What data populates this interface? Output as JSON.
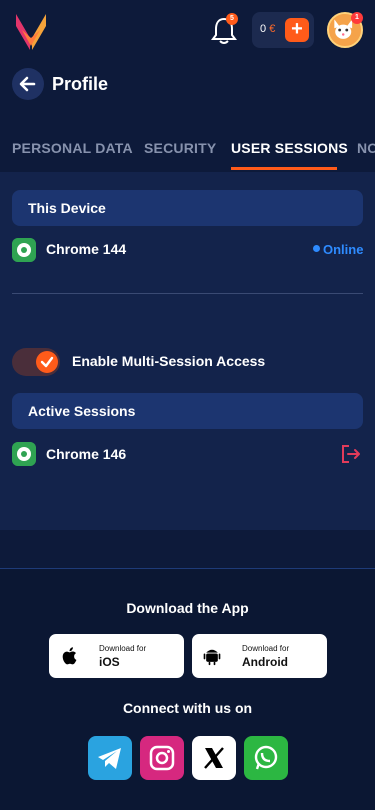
{
  "header": {
    "notification_count": "5",
    "balance_amount": "0",
    "balance_currency": "€",
    "avatar_badge_count": "1"
  },
  "page": {
    "title": "Profile"
  },
  "tabs": [
    {
      "label": "PERSONAL DATA",
      "active": false
    },
    {
      "label": "SECURITY",
      "active": false
    },
    {
      "label": "USER SESSIONS",
      "active": true
    },
    {
      "label": "NO",
      "active": false
    }
  ],
  "this_device": {
    "heading": "This Device",
    "browser": "Chrome 144",
    "status": "Online"
  },
  "multi_session": {
    "label": "Enable Multi-Session Access",
    "enabled": true
  },
  "active_sessions": {
    "heading": "Active Sessions",
    "items": [
      {
        "browser": "Chrome 146"
      }
    ]
  },
  "footer": {
    "download_title": "Download the App",
    "ios": {
      "small": "Download for",
      "big": "iOS"
    },
    "android": {
      "small": "Download for",
      "big": "Android"
    },
    "connect_title": "Connect with us on",
    "socials": [
      "telegram-icon",
      "instagram-icon",
      "x-icon",
      "whatsapp-icon"
    ]
  },
  "colors": {
    "accent": "#ff5b1a",
    "background": "#0d1a3a",
    "online": "#2e8bff"
  }
}
